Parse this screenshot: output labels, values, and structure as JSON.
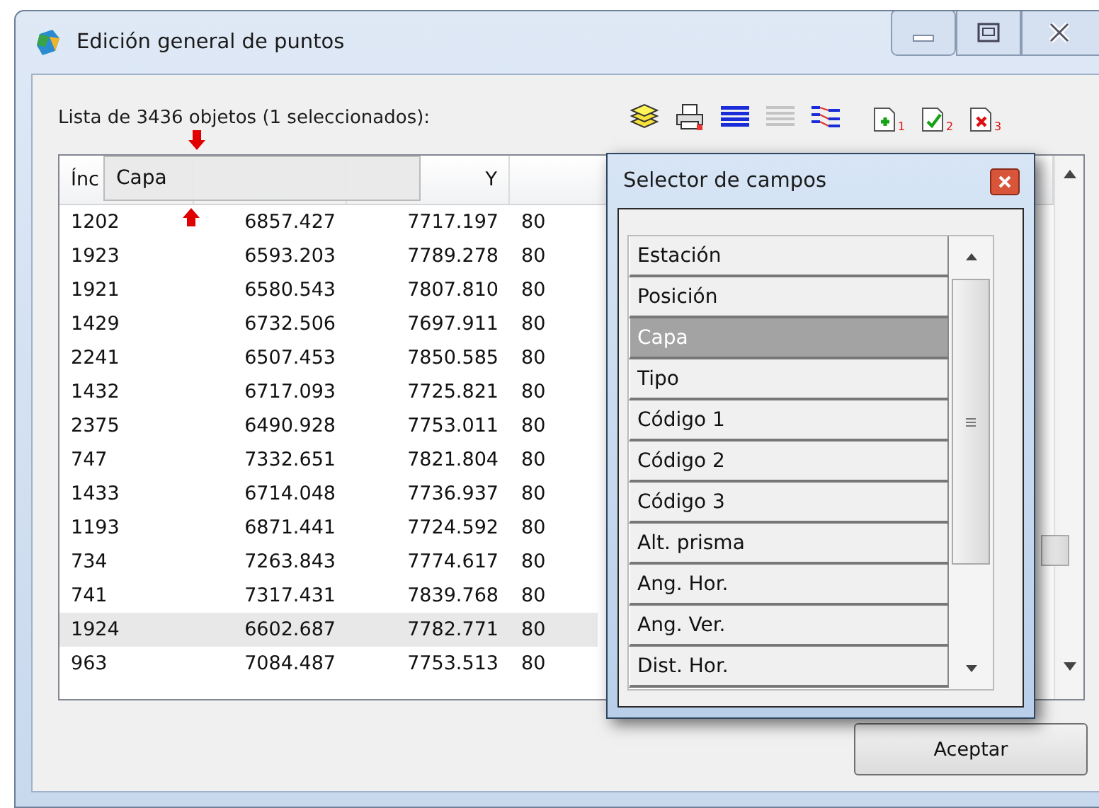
{
  "window": {
    "title": "Edición general de puntos"
  },
  "toolbar": {
    "label": "Lista de 3436 objetos (1 seleccionados):",
    "document_buttons": [
      {
        "kind": "add",
        "subscript": "1"
      },
      {
        "kind": "check",
        "subscript": "2"
      },
      {
        "kind": "remove",
        "subscript": "3"
      }
    ]
  },
  "table": {
    "columns": [
      "Ínc",
      "",
      "Y"
    ],
    "dragged_column": "Capa",
    "rows": [
      {
        "cells": [
          "1202",
          "6857.427",
          "7717.197",
          "80"
        ],
        "selected": false
      },
      {
        "cells": [
          "1923",
          "6593.203",
          "7789.278",
          "80"
        ],
        "selected": false
      },
      {
        "cells": [
          "1921",
          "6580.543",
          "7807.810",
          "80"
        ],
        "selected": false
      },
      {
        "cells": [
          "1429",
          "6732.506",
          "7697.911",
          "80"
        ],
        "selected": false
      },
      {
        "cells": [
          "2241",
          "6507.453",
          "7850.585",
          "80"
        ],
        "selected": false
      },
      {
        "cells": [
          "1432",
          "6717.093",
          "7725.821",
          "80"
        ],
        "selected": false
      },
      {
        "cells": [
          "2375",
          "6490.928",
          "7753.011",
          "80"
        ],
        "selected": false
      },
      {
        "cells": [
          "747",
          "7332.651",
          "7821.804",
          "80"
        ],
        "selected": false
      },
      {
        "cells": [
          "1433",
          "6714.048",
          "7736.937",
          "80"
        ],
        "selected": false
      },
      {
        "cells": [
          "1193",
          "6871.441",
          "7724.592",
          "80"
        ],
        "selected": false
      },
      {
        "cells": [
          "734",
          "7263.843",
          "7774.617",
          "80"
        ],
        "selected": false
      },
      {
        "cells": [
          "741",
          "7317.431",
          "7839.768",
          "80"
        ],
        "selected": false
      },
      {
        "cells": [
          "1924",
          "6602.687",
          "7782.771",
          "80"
        ],
        "selected": true
      },
      {
        "cells": [
          "963",
          "7084.487",
          "7753.513",
          "80"
        ],
        "selected": false
      }
    ]
  },
  "field_selector": {
    "title": "Selector de campos",
    "items": [
      {
        "label": "Estación",
        "selected": false
      },
      {
        "label": "Posición",
        "selected": false
      },
      {
        "label": "Capa",
        "selected": true
      },
      {
        "label": "Tipo",
        "selected": false
      },
      {
        "label": "Código 1",
        "selected": false
      },
      {
        "label": "Código 2",
        "selected": false
      },
      {
        "label": "Código 3",
        "selected": false
      },
      {
        "label": "Alt. prisma",
        "selected": false
      },
      {
        "label": "Ang. Hor.",
        "selected": false
      },
      {
        "label": "Ang. Ver.",
        "selected": false
      },
      {
        "label": "Dist. Hor.",
        "selected": false
      }
    ]
  },
  "buttons": [
    "Aceptar"
  ]
}
